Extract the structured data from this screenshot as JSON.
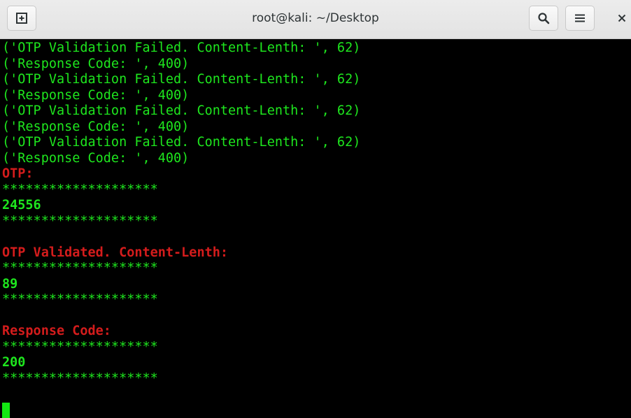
{
  "window": {
    "title": "root@kali: ~/Desktop",
    "close_glyph": "×"
  },
  "toolbar": {
    "new_tab_icon": "plus-box-icon",
    "search_icon": "magnifier-icon",
    "menu_icon": "hamburger-icon"
  },
  "terminal": {
    "lines": [
      {
        "text": "('OTP Validation Failed. Content-Lenth: ', 62)",
        "style": "green"
      },
      {
        "text": "('Response Code: ', 400)",
        "style": "green"
      },
      {
        "text": "('OTP Validation Failed. Content-Lenth: ', 62)",
        "style": "green"
      },
      {
        "text": "('Response Code: ', 400)",
        "style": "green"
      },
      {
        "text": "('OTP Validation Failed. Content-Lenth: ', 62)",
        "style": "green"
      },
      {
        "text": "('Response Code: ', 400)",
        "style": "green"
      },
      {
        "text": "('OTP Validation Failed. Content-Lenth: ', 62)",
        "style": "green"
      },
      {
        "text": "('Response Code: ', 400)",
        "style": "green"
      },
      {
        "text": "OTP:",
        "style": "red"
      },
      {
        "text": "********************",
        "style": "green"
      },
      {
        "text": "24556",
        "style": "green-bold"
      },
      {
        "text": "********************",
        "style": "green"
      },
      {
        "text": "",
        "style": "green"
      },
      {
        "text": "OTP Validated. Content-Lenth:",
        "style": "red"
      },
      {
        "text": "********************",
        "style": "green"
      },
      {
        "text": "89",
        "style": "green-bold"
      },
      {
        "text": "********************",
        "style": "green"
      },
      {
        "text": "",
        "style": "green"
      },
      {
        "text": "Response Code:",
        "style": "red"
      },
      {
        "text": "********************",
        "style": "green"
      },
      {
        "text": "200",
        "style": "green-bold"
      },
      {
        "text": "********************",
        "style": "green"
      },
      {
        "text": "",
        "style": "green"
      }
    ]
  },
  "colors": {
    "output_green": "#1ee61e",
    "label_red": "#d41c1c",
    "cursor": "#13e813",
    "background": "#000000"
  }
}
